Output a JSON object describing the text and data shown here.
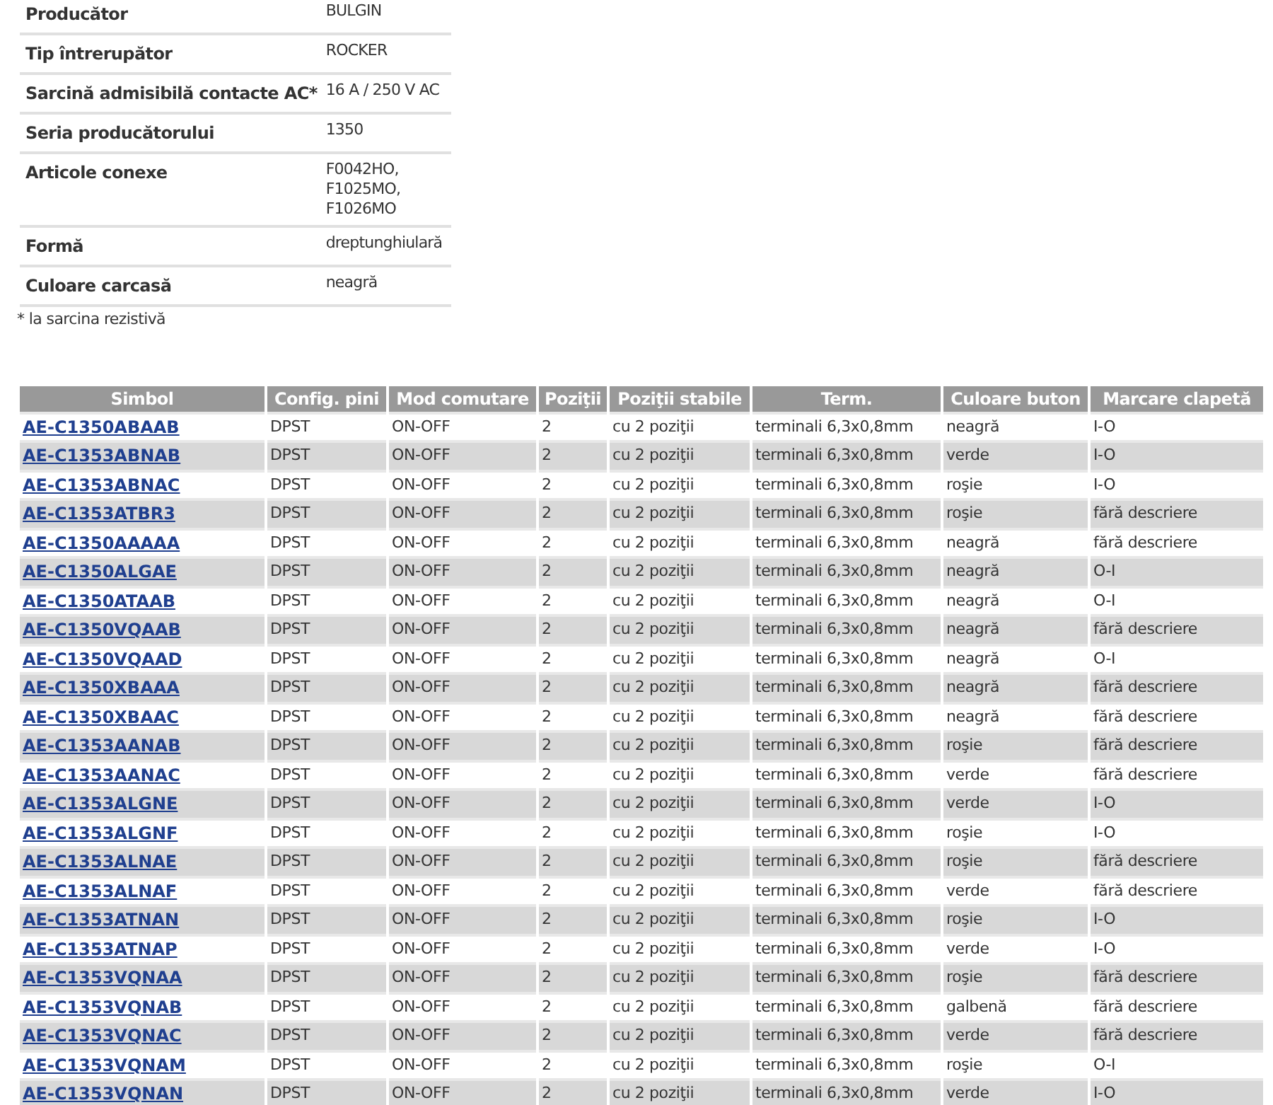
{
  "specs": [
    {
      "label": "Producător",
      "value": [
        "BULGIN"
      ]
    },
    {
      "label": "Tip întrerupător",
      "value": [
        "ROCKER"
      ]
    },
    {
      "label": "Sarcină admisibilă contacte AC*",
      "value": [
        "16 A / 250 V AC"
      ]
    },
    {
      "label": "Seria producătorului",
      "value": [
        "1350"
      ]
    },
    {
      "label": "Articole conexe",
      "value": [
        "F0042HO,",
        "F1025MO,",
        "F1026MO"
      ]
    },
    {
      "label": "Formă",
      "value": [
        "dreptunghiulară"
      ]
    },
    {
      "label": "Culoare carcasă",
      "value": [
        "neagră"
      ]
    }
  ],
  "footnote": "* la sarcina rezistivă",
  "table": {
    "columns": [
      "Simbol",
      "Config. pini",
      "Mod comutare",
      "Poziţii",
      "Poziţii stabile",
      "Term.",
      "Culoare buton",
      "Marcare clapetă"
    ],
    "rows": [
      [
        "AE-C1350ABAAB",
        "DPST",
        "ON-OFF",
        "2",
        "cu 2 poziţii",
        "terminali 6,3x0,8mm",
        "neagră",
        "I-O"
      ],
      [
        "AE-C1353ABNAB",
        "DPST",
        "ON-OFF",
        "2",
        "cu 2 poziţii",
        "terminali 6,3x0,8mm",
        "verde",
        "I-O"
      ],
      [
        "AE-C1353ABNAC",
        "DPST",
        "ON-OFF",
        "2",
        "cu 2 poziţii",
        "terminali 6,3x0,8mm",
        "roşie",
        "I-O"
      ],
      [
        "AE-C1353ATBR3",
        "DPST",
        "ON-OFF",
        "2",
        "cu 2 poziţii",
        "terminali 6,3x0,8mm",
        "roşie",
        "fără descriere"
      ],
      [
        "AE-C1350AAAAA",
        "DPST",
        "ON-OFF",
        "2",
        "cu 2 poziţii",
        "terminali 6,3x0,8mm",
        "neagră",
        "fără descriere"
      ],
      [
        "AE-C1350ALGAE",
        "DPST",
        "ON-OFF",
        "2",
        "cu 2 poziţii",
        "terminali 6,3x0,8mm",
        "neagră",
        "O-I"
      ],
      [
        "AE-C1350ATAAB",
        "DPST",
        "ON-OFF",
        "2",
        "cu 2 poziţii",
        "terminali 6,3x0,8mm",
        "neagră",
        "O-I"
      ],
      [
        "AE-C1350VQAAB",
        "DPST",
        "ON-OFF",
        "2",
        "cu 2 poziţii",
        "terminali 6,3x0,8mm",
        "neagră",
        "fără descriere"
      ],
      [
        "AE-C1350VQAAD",
        "DPST",
        "ON-OFF",
        "2",
        "cu 2 poziţii",
        "terminali 6,3x0,8mm",
        "neagră",
        "O-I"
      ],
      [
        "AE-C1350XBAAA",
        "DPST",
        "ON-OFF",
        "2",
        "cu 2 poziţii",
        "terminali 6,3x0,8mm",
        "neagră",
        "fără descriere"
      ],
      [
        "AE-C1350XBAAC",
        "DPST",
        "ON-OFF",
        "2",
        "cu 2 poziţii",
        "terminali 6,3x0,8mm",
        "neagră",
        "fără descriere"
      ],
      [
        "AE-C1353AANAB",
        "DPST",
        "ON-OFF",
        "2",
        "cu 2 poziţii",
        "terminali 6,3x0,8mm",
        "roşie",
        "fără descriere"
      ],
      [
        "AE-C1353AANAC",
        "DPST",
        "ON-OFF",
        "2",
        "cu 2 poziţii",
        "terminali 6,3x0,8mm",
        "verde",
        "fără descriere"
      ],
      [
        "AE-C1353ALGNE",
        "DPST",
        "ON-OFF",
        "2",
        "cu 2 poziţii",
        "terminali 6,3x0,8mm",
        "verde",
        "I-O"
      ],
      [
        "AE-C1353ALGNF",
        "DPST",
        "ON-OFF",
        "2",
        "cu 2 poziţii",
        "terminali 6,3x0,8mm",
        "roşie",
        "I-O"
      ],
      [
        "AE-C1353ALNAE",
        "DPST",
        "ON-OFF",
        "2",
        "cu 2 poziţii",
        "terminali 6,3x0,8mm",
        "roşie",
        "fără descriere"
      ],
      [
        "AE-C1353ALNAF",
        "DPST",
        "ON-OFF",
        "2",
        "cu 2 poziţii",
        "terminali 6,3x0,8mm",
        "verde",
        "fără descriere"
      ],
      [
        "AE-C1353ATNAN",
        "DPST",
        "ON-OFF",
        "2",
        "cu 2 poziţii",
        "terminali 6,3x0,8mm",
        "roşie",
        "I-O"
      ],
      [
        "AE-C1353ATNAP",
        "DPST",
        "ON-OFF",
        "2",
        "cu 2 poziţii",
        "terminali 6,3x0,8mm",
        "verde",
        "I-O"
      ],
      [
        "AE-C1353VQNAA",
        "DPST",
        "ON-OFF",
        "2",
        "cu 2 poziţii",
        "terminali 6,3x0,8mm",
        "roşie",
        "fără descriere"
      ],
      [
        "AE-C1353VQNAB",
        "DPST",
        "ON-OFF",
        "2",
        "cu 2 poziţii",
        "terminali 6,3x0,8mm",
        "galbenă",
        "fără descriere"
      ],
      [
        "AE-C1353VQNAC",
        "DPST",
        "ON-OFF",
        "2",
        "cu 2 poziţii",
        "terminali 6,3x0,8mm",
        "verde",
        "fără descriere"
      ],
      [
        "AE-C1353VQNAM",
        "DPST",
        "ON-OFF",
        "2",
        "cu 2 poziţii",
        "terminali 6,3x0,8mm",
        "roşie",
        "O-I"
      ],
      [
        "AE-C1353VQNAN",
        "DPST",
        "ON-OFF",
        "2",
        "cu 2 poziţii",
        "terminali 6,3x0,8mm",
        "verde",
        "I-O"
      ]
    ]
  }
}
